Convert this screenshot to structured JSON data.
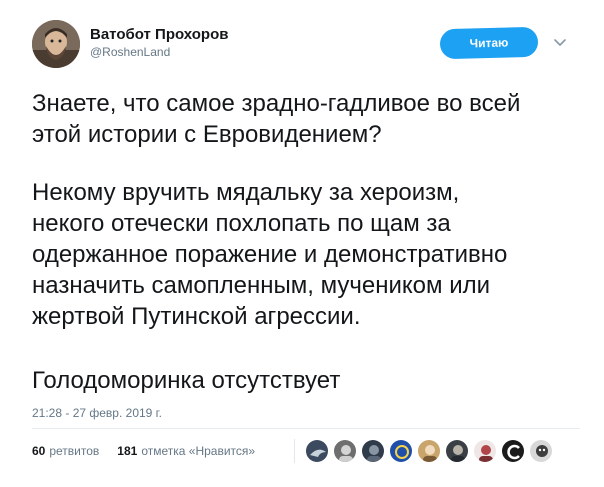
{
  "author": {
    "display_name": "Ватобот Прохоров",
    "handle": "@RoshenLand"
  },
  "follow_button": {
    "label": "Читаю"
  },
  "tweet": {
    "paragraphs": [
      "Знаете, что самое зрадно-гадливое во всей\nэтой истории с Евровидением?",
      "Некому вручить мядальку за хероизм,\nнекого отечески похлопать по щам за\nодержанное поражение и демонстративно\nназначить самопленным, мучеником или\nжертвой Путинской агрессии.",
      "Голодоморинка отсутствует"
    ],
    "timestamp": "21:28 - 27 февр. 2019 г."
  },
  "stats": {
    "retweets_count": "60",
    "retweets_label": "ретвитов",
    "likes_count": "181",
    "likes_label": "отметка «Нравится»"
  },
  "likers": [
    {
      "icon": "avatar-bird",
      "color": "#3b4a5e"
    },
    {
      "icon": "avatar-face",
      "color": "#6e6e6e"
    },
    {
      "icon": "avatar-face",
      "color": "#2f3a4a"
    },
    {
      "icon": "avatar-badge",
      "color": "#1f4fa8"
    },
    {
      "icon": "avatar-face",
      "color": "#c9a56c"
    },
    {
      "icon": "avatar-face",
      "color": "#3a3f46"
    },
    {
      "icon": "avatar-face",
      "color": "#b0464a"
    },
    {
      "icon": "avatar-logo",
      "color": "#1b1b1b"
    },
    {
      "icon": "avatar-face",
      "color": "#d8d8d8"
    }
  ],
  "colors": {
    "accent": "#1da1f2",
    "text": "#14171a",
    "muted": "#657786"
  }
}
